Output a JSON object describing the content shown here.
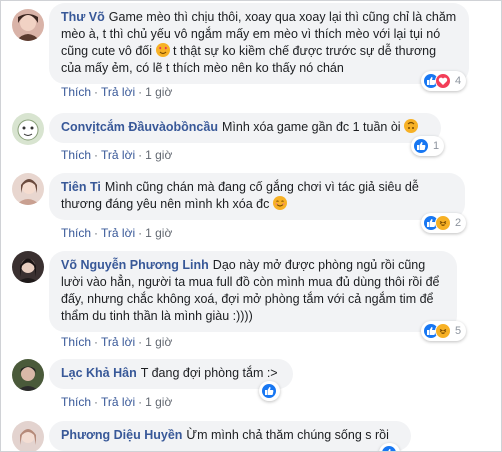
{
  "comments": [
    {
      "author": "Thư Võ",
      "text": "Game mèo thì chịu thôi, xoay qua xoay lại thì cũng chỉ là chăm mèo à, t thì chủ yếu vô ngắm mấy em mèo vì thích mèo với lại tụi nó cũng cute vô đối",
      "text2": " t thật sự ko kiềm chế được trước sự dễ thương của mấy ẻm, có lẽ t thích mèo nên ko thấy nó chán",
      "emoji_icon": "heart-eyes-emoji-icon",
      "like_label": "Thích",
      "reply_label": "Trả lời",
      "time": "1 giờ",
      "reactions": [
        "like",
        "love"
      ],
      "reaction_count": "4"
    },
    {
      "author": "Convịtcắm Đầuvàobồncầu",
      "text": "Mình xóa game gần đc 1 tuần òi",
      "emoji_icon": "upside-down-face-emoji-icon",
      "like_label": "Thích",
      "reply_label": "Trả lời",
      "time": "1 giờ",
      "reactions": [
        "like"
      ],
      "reaction_count": "1"
    },
    {
      "author": "Tiên Ti",
      "text": "Mình cũng chán mà đang cố gắng chơi vì tác giả siêu dễ thương đáng yêu nên mình kh xóa đc",
      "emoji_icon": "smiling-face-emoji-icon",
      "like_label": "Thích",
      "reply_label": "Trả lời",
      "time": "1 giờ",
      "reactions": [
        "like",
        "haha"
      ],
      "reaction_count": "2"
    },
    {
      "author": "Võ Nguyễn Phương Linh",
      "text": "Dạo này mở được phòng ngủ rồi cũng lười vào hẳn, người ta mua full đồ còn mình mua đủ dùng thôi rồi để đấy, nhưng chắc không xoá, đợi mở phòng tắm với cả ngắm tim để thẩm du tinh thần là mình giàu :))))",
      "like_label": "Thích",
      "reply_label": "Trả lời",
      "time": "1 giờ",
      "reactions": [
        "like",
        "haha"
      ],
      "reaction_count": "5"
    },
    {
      "author": "Lạc Khả Hân",
      "text": "T đang đợi phòng tắm :>",
      "like_label": "Thích",
      "reply_label": "Trả lời",
      "time": "1 giờ",
      "reactions": [
        "like"
      ],
      "reaction_count": ""
    },
    {
      "author": "Phương Diệu Huyền",
      "text": "Ừm mình chả thăm chúng sống s rồi",
      "reactions": [
        "like"
      ],
      "reaction_count": ""
    }
  ],
  "colors": {
    "author": "#385898",
    "bubble": "#f2f3f5",
    "like": "#1877f2",
    "haha": "#f7b125"
  }
}
